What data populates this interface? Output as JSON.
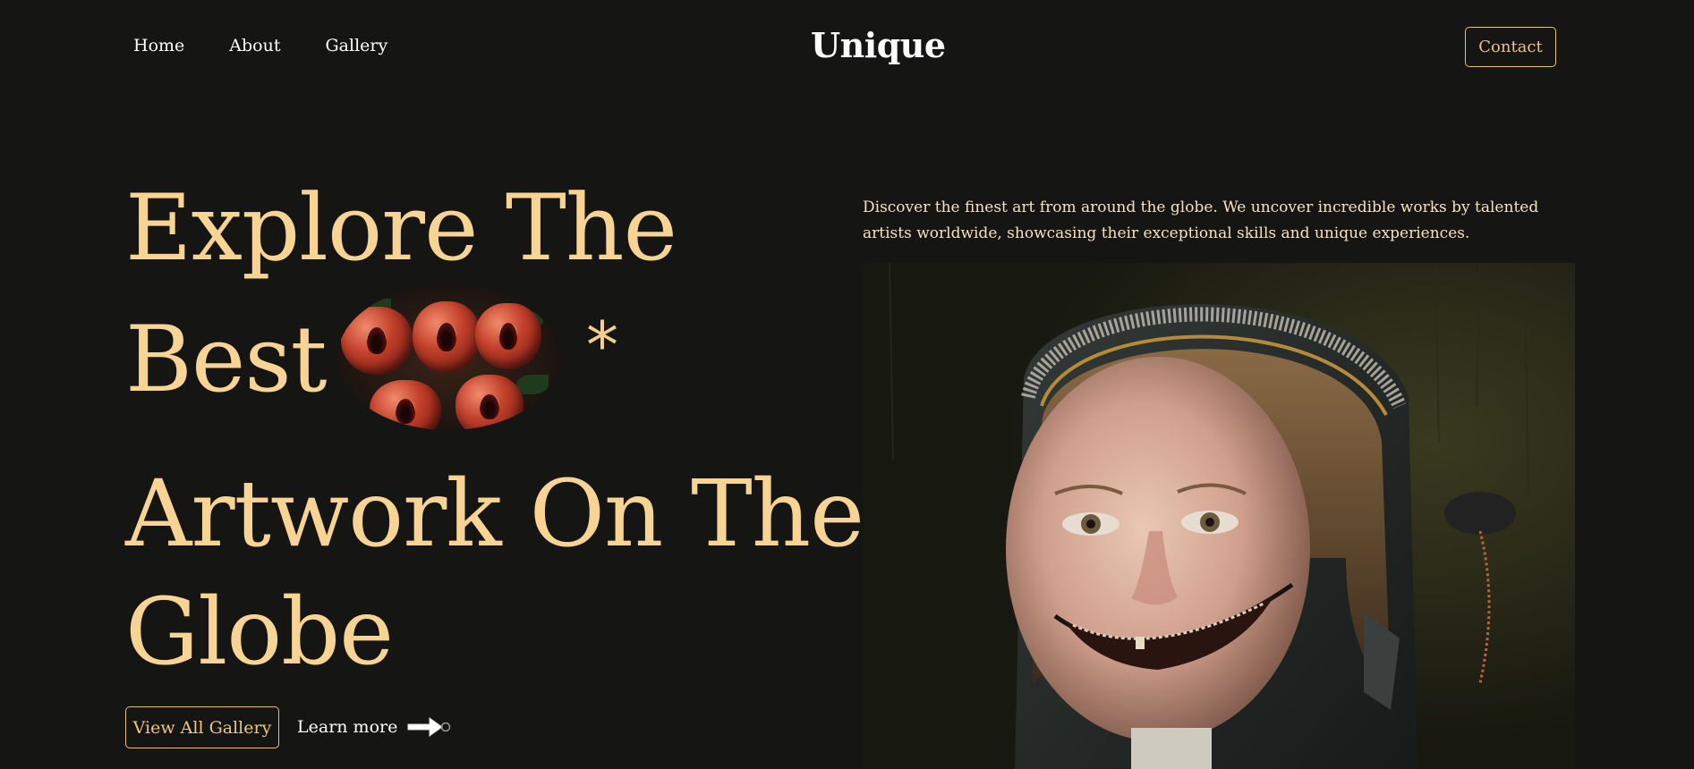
{
  "nav": {
    "links": [
      "Home",
      "About",
      "Gallery"
    ],
    "brand": "Unique",
    "contact_label": "Contact"
  },
  "hero": {
    "line1": "Explore The",
    "line2": "Best",
    "asterisk": "*",
    "line3": "Artwork On The",
    "line4": "Globe",
    "gallery_button": "View All Gallery",
    "learn_more": "Learn more"
  },
  "intro": {
    "description": "Discover the finest art from around the globe. We uncover incredible works by talented artists worldwide, showcasing their exceptional skills and unique experiences."
  },
  "colors": {
    "background": "#151513",
    "accent": "#f7d394",
    "nav_text": "#ffffff"
  },
  "icons": {
    "learn_more_arrow": "arrow-right-icon"
  }
}
